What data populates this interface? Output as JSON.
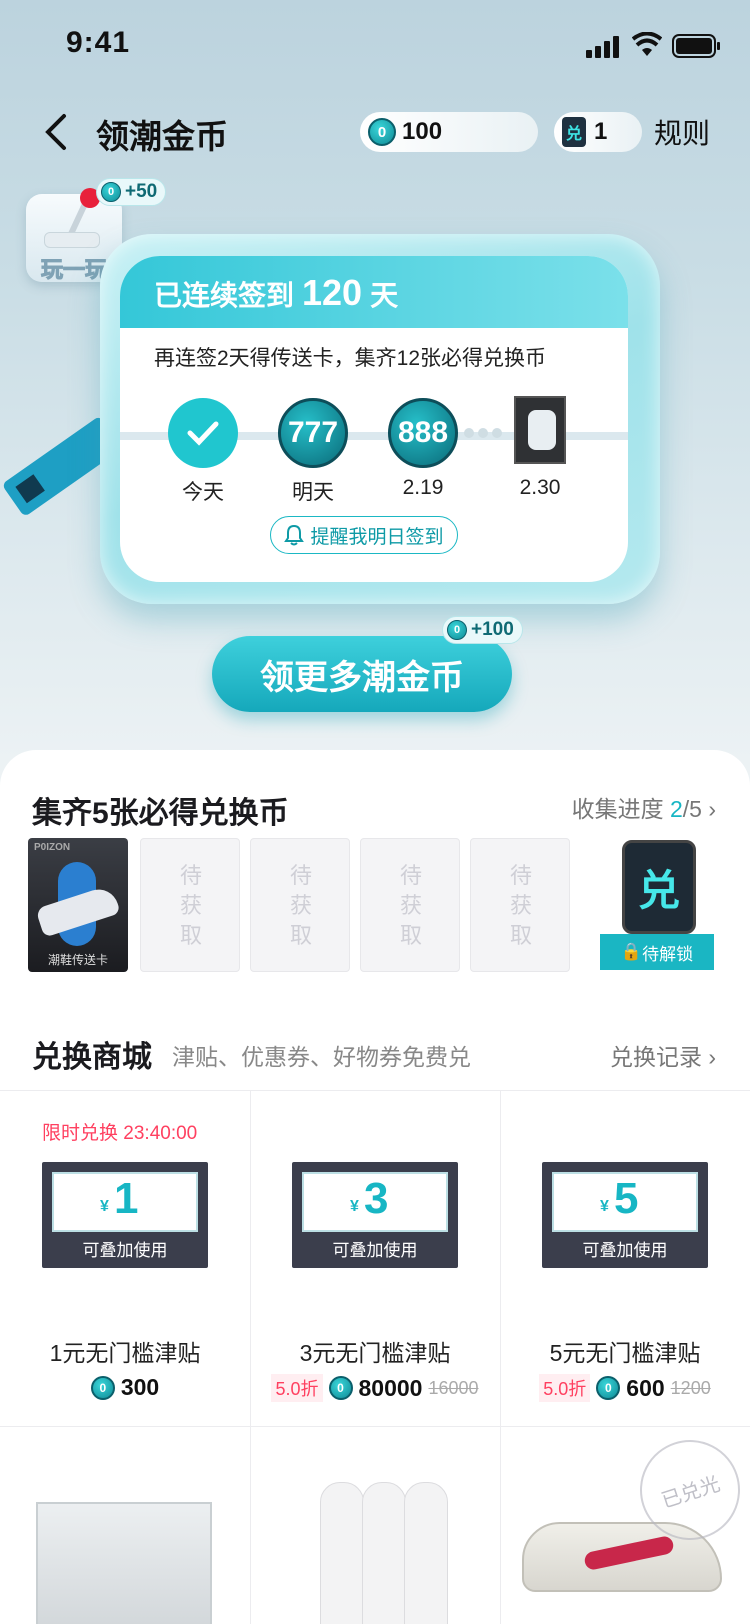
{
  "status_bar": {
    "time": "9:41"
  },
  "nav": {
    "title": "领潮金币",
    "coin_count": "100",
    "card_count": "1",
    "rules": "规则",
    "coin_glyph": "0",
    "card_glyph": "兑"
  },
  "play": {
    "label": "玩一玩",
    "bonus": "+50"
  },
  "signin": {
    "header_prefix": "已连续签到",
    "days": "120",
    "header_suffix": "天",
    "subtitle": "再连签2天得传送卡，集齐12张必得兑换币",
    "steps": [
      {
        "label": "今天",
        "value": ""
      },
      {
        "label": "明天",
        "value": "777"
      },
      {
        "label": "2.19",
        "value": "888"
      },
      {
        "label": "2.30",
        "value": ""
      }
    ],
    "remind": "提醒我明日签到"
  },
  "cta": {
    "label": "领更多潮金币",
    "bonus": "+100"
  },
  "collect": {
    "title": "集齐5张必得兑换币",
    "progress_label": "收集进度",
    "progress_current": "2",
    "progress_total": "/5",
    "first_card_brand": "P0IZON",
    "first_card_caption": "潮鞋传送卡",
    "pending": "待获取",
    "exchange_glyph": "兑",
    "unlock": "待解锁"
  },
  "mall": {
    "title": "兑换商城",
    "subtitle": "津贴、优惠券、好物券免费兑",
    "records": "兑换记录",
    "products": [
      {
        "limit": "限时兑换 23:40:00",
        "yen": "¥",
        "amount": "1",
        "can": "可叠加使用",
        "name": "1元无门槛津贴",
        "discount": "",
        "price": "300",
        "old": ""
      },
      {
        "limit": "",
        "yen": "¥",
        "amount": "3",
        "can": "可叠加使用",
        "name": "3元无门槛津贴",
        "discount": "5.0折",
        "price": "80000",
        "old": "16000"
      },
      {
        "limit": "",
        "yen": "¥",
        "amount": "5",
        "can": "可叠加使用",
        "name": "5元无门槛津贴",
        "discount": "5.0折",
        "price": "600",
        "old": "1200"
      }
    ],
    "sold_out": "已兑光"
  },
  "colors": {
    "accent": "#17b6c4",
    "red": "#ff4060"
  }
}
